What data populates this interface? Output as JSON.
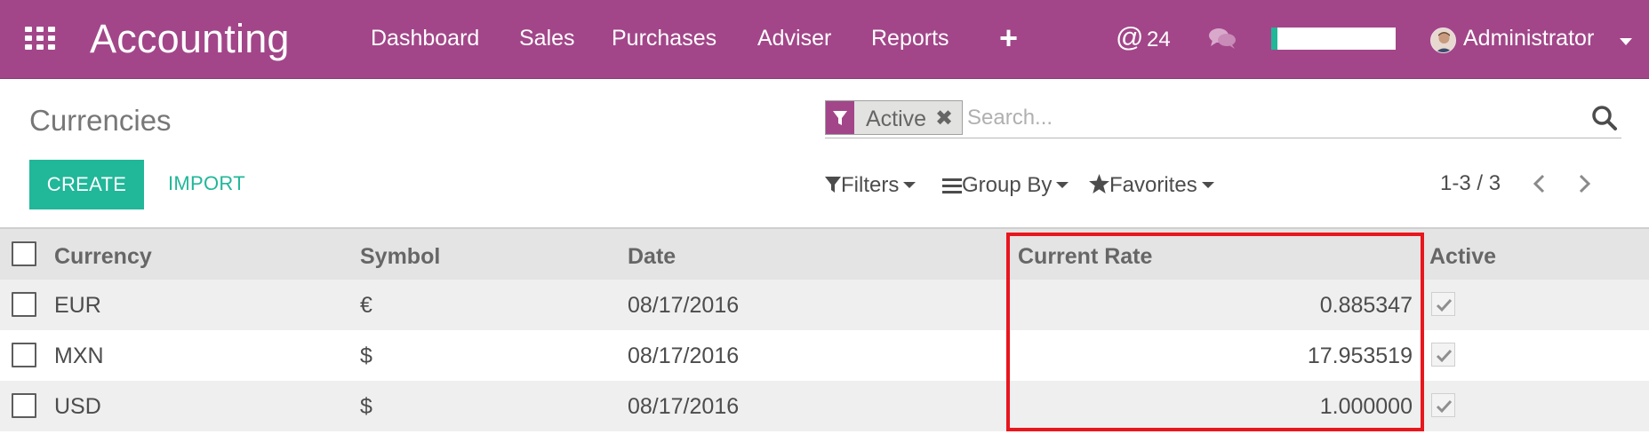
{
  "topbar": {
    "app_title": "Accounting",
    "nav": [
      "Dashboard",
      "Sales",
      "Purchases",
      "Adviser",
      "Reports"
    ],
    "plus": "+",
    "message_count": "24",
    "progress_fraction": 0.05,
    "user": "Administrator",
    "icons": [
      "apps-grid-icon",
      "plus-icon",
      "at-icon",
      "chat-icon",
      "avatar"
    ],
    "colors": {
      "primary": "#a24689",
      "accent": "#21b799"
    }
  },
  "control_panel": {
    "title": "Currencies",
    "search": {
      "facet": "Active",
      "facet_close": "✖",
      "placeholder": "Search..."
    },
    "buttons": {
      "create": "CREATE",
      "import": "IMPORT"
    },
    "tools": {
      "filters": "Filters",
      "group_by": "Group By",
      "favorites": "Favorites"
    },
    "pager": {
      "value": "1-3 / 3"
    }
  },
  "table": {
    "headers": {
      "currency": "Currency",
      "symbol": "Symbol",
      "date": "Date",
      "rate": "Current Rate",
      "active": "Active"
    },
    "rows": [
      {
        "currency": "EUR",
        "symbol": "€",
        "date": "08/17/2016",
        "rate": "0.885347",
        "active": true
      },
      {
        "currency": "MXN",
        "symbol": "$",
        "date": "08/17/2016",
        "rate": "17.953519",
        "active": true
      },
      {
        "currency": "USD",
        "symbol": "$",
        "date": "08/17/2016",
        "rate": "1.000000",
        "active": true
      }
    ],
    "highlight_color": "#e8161d"
  }
}
